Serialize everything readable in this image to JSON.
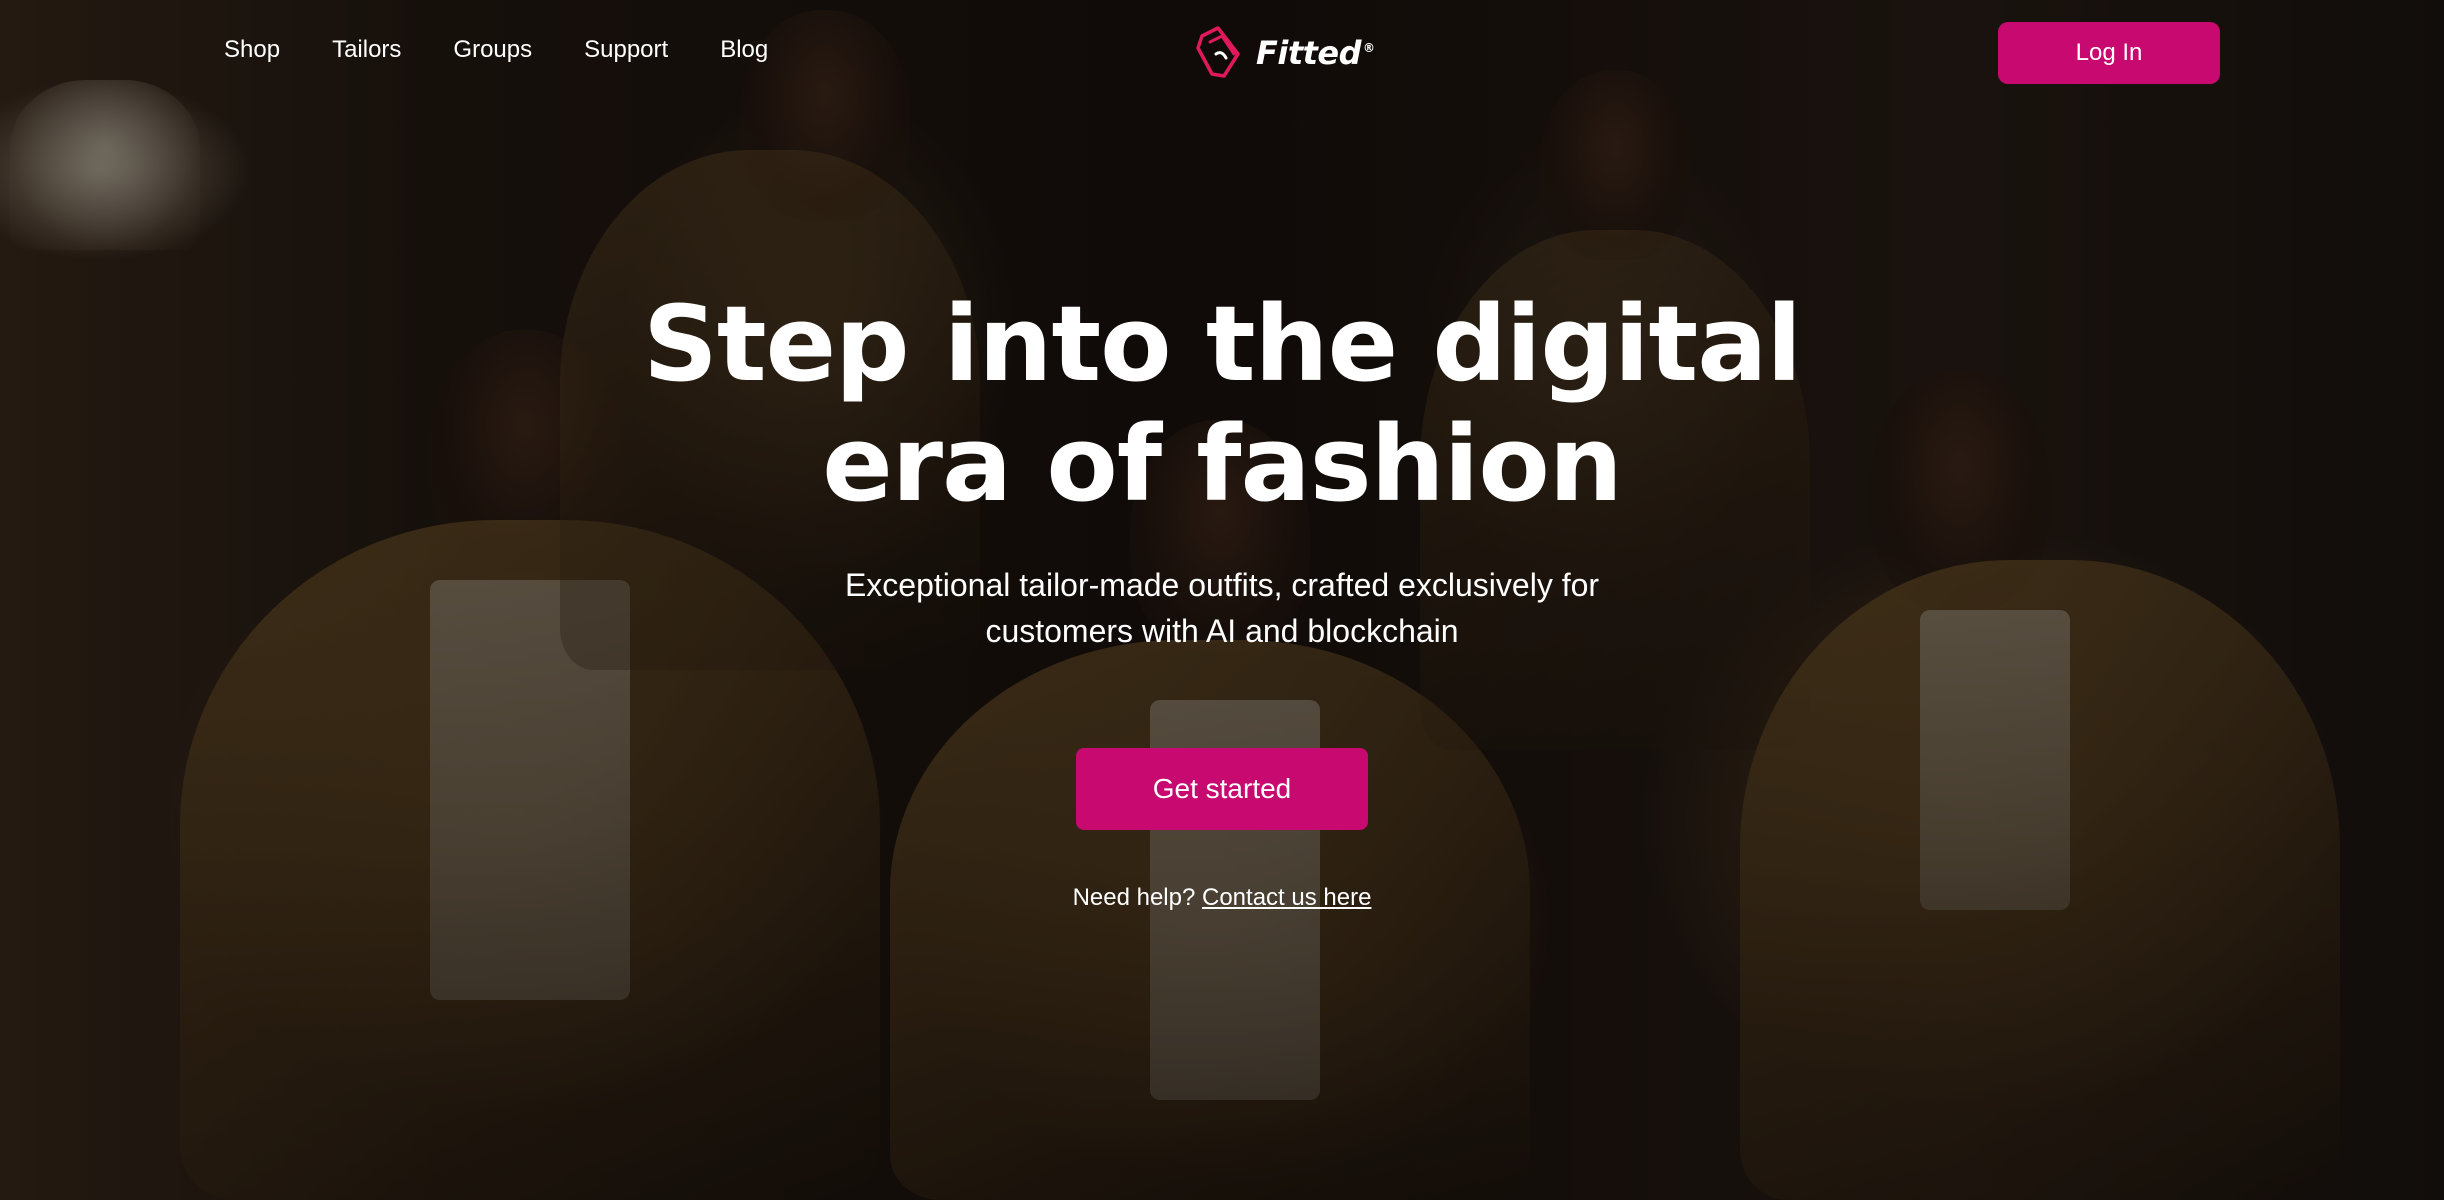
{
  "nav": {
    "links": [
      "Shop",
      "Tailors",
      "Groups",
      "Support",
      "Blog"
    ],
    "login_label": "Log In"
  },
  "brand": {
    "name": "Fitted",
    "mark": "®",
    "accent_color": "#c80a70"
  },
  "hero": {
    "title_line1": "Step into the digital",
    "title_line2": "era of fashion",
    "subtitle": "Exceptional tailor-made outfits, crafted exclusively for customers with AI and blockchain",
    "cta_label": "Get started",
    "help_prefix": "Need help?",
    "help_link": "Contact us here"
  }
}
